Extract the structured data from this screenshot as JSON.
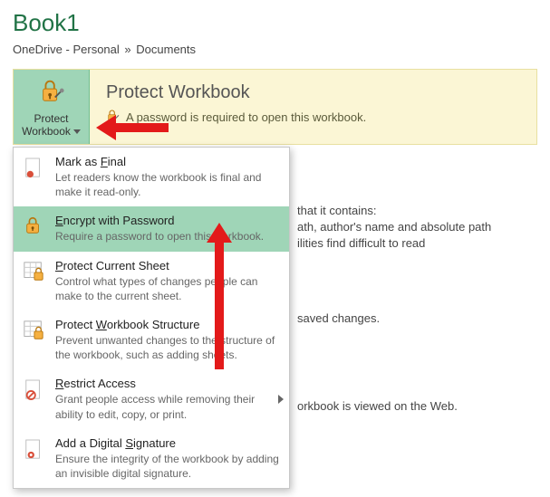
{
  "header": {
    "title": "Book1",
    "breadcrumb_loc": "OneDrive - Personal",
    "breadcrumb_sep": "»",
    "breadcrumb_folder": "Documents"
  },
  "banner": {
    "button_line1": "Protect",
    "button_line2": "Workbook",
    "title": "Protect Workbook",
    "subtitle": "A password is required to open this workbook."
  },
  "menu": {
    "items": [
      {
        "title_pre": "Mark as ",
        "title_u": "F",
        "title_post": "inal",
        "desc": "Let readers know the workbook is final and make it read-only."
      },
      {
        "title_pre": "",
        "title_u": "E",
        "title_post": "ncrypt with Password",
        "desc": "Require a password to open this workbook."
      },
      {
        "title_pre": "",
        "title_u": "P",
        "title_post": "rotect Current Sheet",
        "desc": "Control what types of changes people can make to the current sheet."
      },
      {
        "title_pre": "Protect ",
        "title_u": "W",
        "title_post": "orkbook Structure",
        "desc": "Prevent unwanted changes to the structure of the workbook, such as adding sheets."
      },
      {
        "title_pre": "",
        "title_u": "R",
        "title_post": "estrict Access",
        "desc": "Grant people access while removing their ability to edit, copy, or print."
      },
      {
        "title_pre": "Add a Digital ",
        "title_u": "S",
        "title_post": "ignature",
        "desc": "Ensure the integrity of the workbook by adding an invisible digital signature."
      }
    ]
  },
  "bgtext": {
    "t1": "that it contains:",
    "t2": "ath, author's name and absolute path",
    "t3": "ilities find difficult to read",
    "t4": "saved changes.",
    "t5": "orkbook is viewed on the Web."
  }
}
